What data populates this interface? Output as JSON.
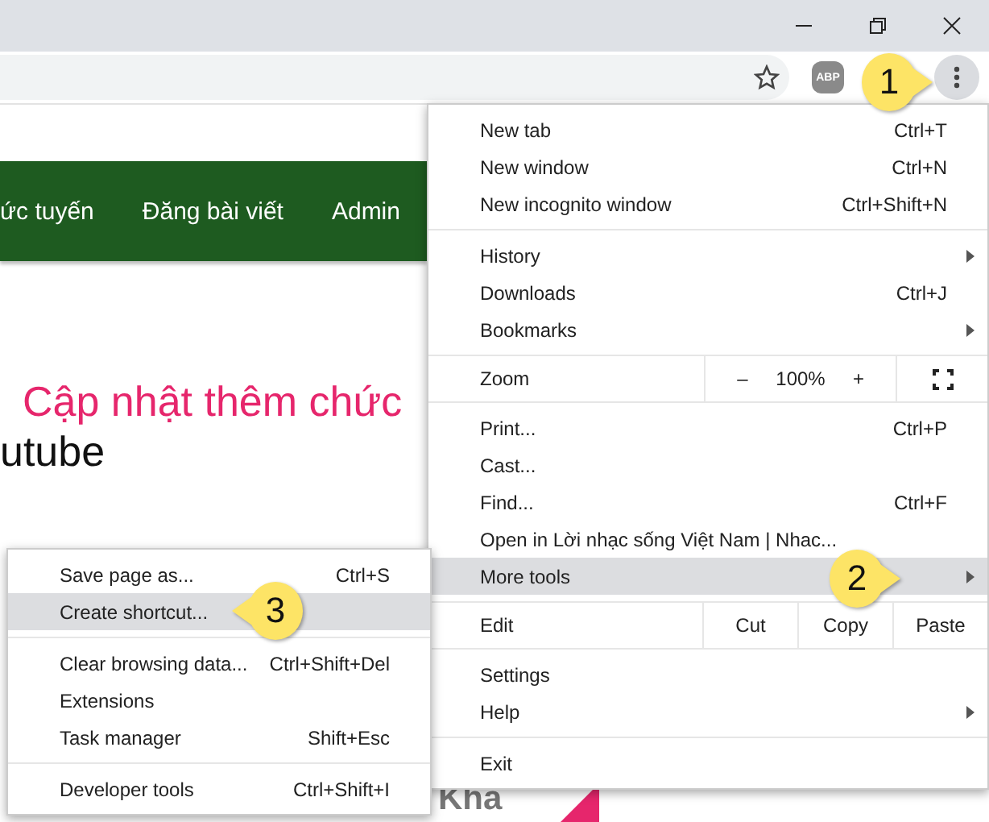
{
  "toolbar": {
    "extension_label": "ABP",
    "menu_button_pressed": true
  },
  "page": {
    "nav": [
      "ức tuyến",
      "Đăng bài viết",
      "Admin"
    ],
    "heading": "Cập nhật thêm chức",
    "subheading": "utube",
    "footer_text": "Kha"
  },
  "menu": [
    {
      "kind": "item",
      "label": "New tab",
      "shortcut": "Ctrl+T",
      "submenu": false,
      "selected": false
    },
    {
      "kind": "item",
      "label": "New window",
      "shortcut": "Ctrl+N",
      "submenu": false,
      "selected": false
    },
    {
      "kind": "item",
      "label": "New incognito window",
      "shortcut": "Ctrl+Shift+N",
      "submenu": false,
      "selected": false
    },
    {
      "kind": "separator"
    },
    {
      "kind": "item",
      "label": "History",
      "submenu": true,
      "selected": false
    },
    {
      "kind": "item",
      "label": "Downloads",
      "shortcut": "Ctrl+J",
      "submenu": false,
      "selected": false
    },
    {
      "kind": "item",
      "label": "Bookmarks",
      "submenu": true,
      "selected": false
    },
    {
      "kind": "separator"
    },
    {
      "kind": "zoom",
      "label": "Zoom",
      "minus": "–",
      "value": "100%",
      "plus": "+"
    },
    {
      "kind": "separator"
    },
    {
      "kind": "item",
      "label": "Print...",
      "shortcut": "Ctrl+P",
      "submenu": false,
      "selected": false
    },
    {
      "kind": "item",
      "label": "Cast...",
      "submenu": false,
      "selected": false
    },
    {
      "kind": "item",
      "label": "Find...",
      "shortcut": "Ctrl+F",
      "submenu": false,
      "selected": false
    },
    {
      "kind": "item",
      "label": "Open in Lời nhạc sống Việt Nam | Nhac...",
      "submenu": false,
      "selected": false
    },
    {
      "kind": "item",
      "label": "More tools",
      "submenu": true,
      "selected": true
    },
    {
      "kind": "separator"
    },
    {
      "kind": "edit",
      "label": "Edit",
      "buttons": [
        "Cut",
        "Copy",
        "Paste"
      ]
    },
    {
      "kind": "separator"
    },
    {
      "kind": "item",
      "label": "Settings",
      "submenu": false,
      "selected": false
    },
    {
      "kind": "item",
      "label": "Help",
      "submenu": true,
      "selected": false
    },
    {
      "kind": "separator"
    },
    {
      "kind": "item",
      "label": "Exit",
      "submenu": false,
      "selected": false
    }
  ],
  "submenu": [
    {
      "kind": "item",
      "label": "Save page as...",
      "shortcut": "Ctrl+S",
      "selected": false
    },
    {
      "kind": "item",
      "label": "Create shortcut...",
      "selected": true
    },
    {
      "kind": "separator"
    },
    {
      "kind": "item",
      "label": "Clear browsing data...",
      "shortcut": "Ctrl+Shift+Del",
      "selected": false
    },
    {
      "kind": "item",
      "label": "Extensions",
      "selected": false
    },
    {
      "kind": "item",
      "label": "Task manager",
      "shortcut": "Shift+Esc",
      "selected": false
    },
    {
      "kind": "separator"
    },
    {
      "kind": "item",
      "label": "Developer tools",
      "shortcut": "Ctrl+Shift+I",
      "selected": false
    }
  ],
  "callouts": [
    {
      "number": "1"
    },
    {
      "number": "2"
    },
    {
      "number": "3"
    }
  ]
}
